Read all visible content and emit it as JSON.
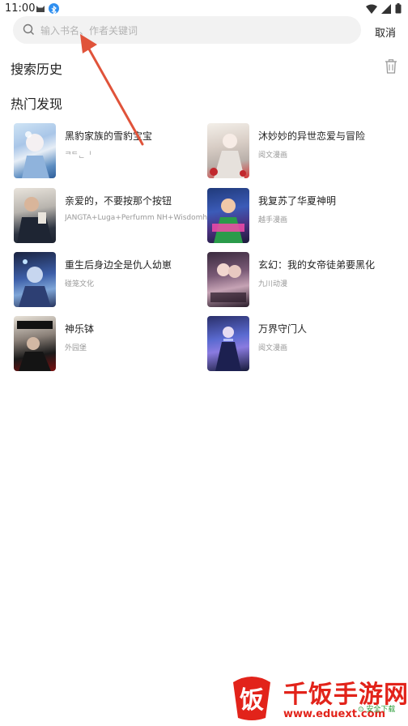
{
  "status_bar": {
    "time": "11:00"
  },
  "search": {
    "placeholder": "输入书名、作者关键词",
    "value": "",
    "cancel_label": "取消"
  },
  "sections": {
    "history_title": "搜索历史",
    "hot_title": "热门发现"
  },
  "books": [
    {
      "title": "黑豹家族的雪豹宝宝",
      "author": "ᄏᄃᆫᅵ"
    },
    {
      "title": "沐妙妙的异世恋爱与冒险",
      "author": "阅文漫画"
    },
    {
      "title": "亲爱的，不要按那个按钮",
      "author": "JANGTA+Luga+Perfumm NH+Wisdomhou..."
    },
    {
      "title": "我复苏了华夏神明",
      "author": "越手漫画"
    },
    {
      "title": "重生后身边全是仇人幼崽",
      "author": "碰笼文化"
    },
    {
      "title": "玄幻：我的女帝徒弟要黑化",
      "author": "九川动漫"
    },
    {
      "title": "神乐钵",
      "author": "外园堡"
    },
    {
      "title": "万界守门人",
      "author": "阅文漫画"
    }
  ],
  "colors": {
    "accent": "#e2231a",
    "text": "#222222",
    "muted": "#999999",
    "search_bg": "#f2f2f2",
    "annotation_arrow": "#e0533a"
  },
  "watermark": {
    "logo_char": "饭",
    "title": "千饭手游网",
    "url": "www.eduext.com",
    "badge": "⊙ 安全下载"
  }
}
